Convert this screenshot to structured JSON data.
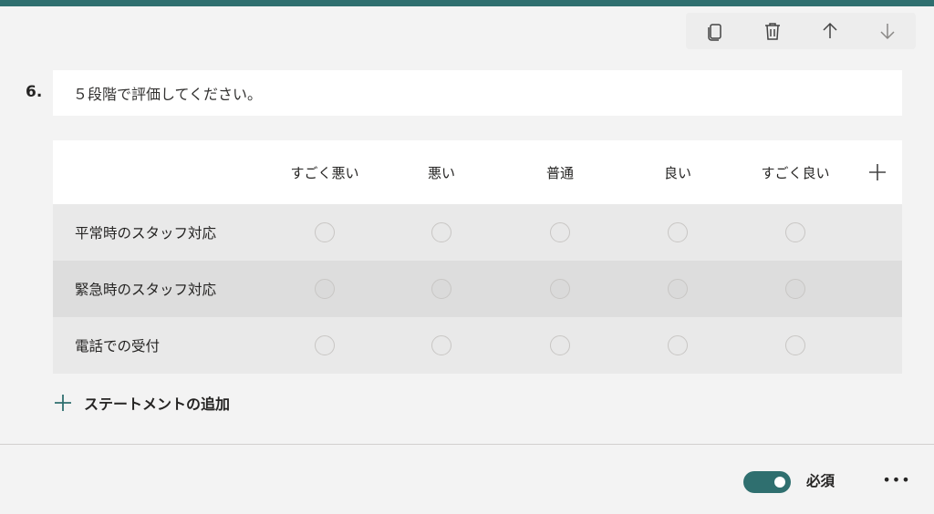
{
  "question": {
    "number": "6.",
    "title": "５段階で評価してください。"
  },
  "toolbar": {
    "icons": [
      "copy-icon",
      "delete-icon",
      "move-up-icon",
      "move-down-icon"
    ]
  },
  "likert": {
    "options": [
      "すごく悪い",
      "悪い",
      "普通",
      "良い",
      "すごく良い"
    ],
    "statements": [
      "平常時のスタッフ対応",
      "緊急時のスタッフ対応",
      "電話での受付"
    ]
  },
  "add_statement_label": "ステートメントの追加",
  "required": {
    "label": "必須",
    "on": true
  },
  "more_label": "•••",
  "colors": {
    "accent": "#2f6f6f",
    "surface": "#ffffff",
    "background": "#f3f3f3"
  }
}
